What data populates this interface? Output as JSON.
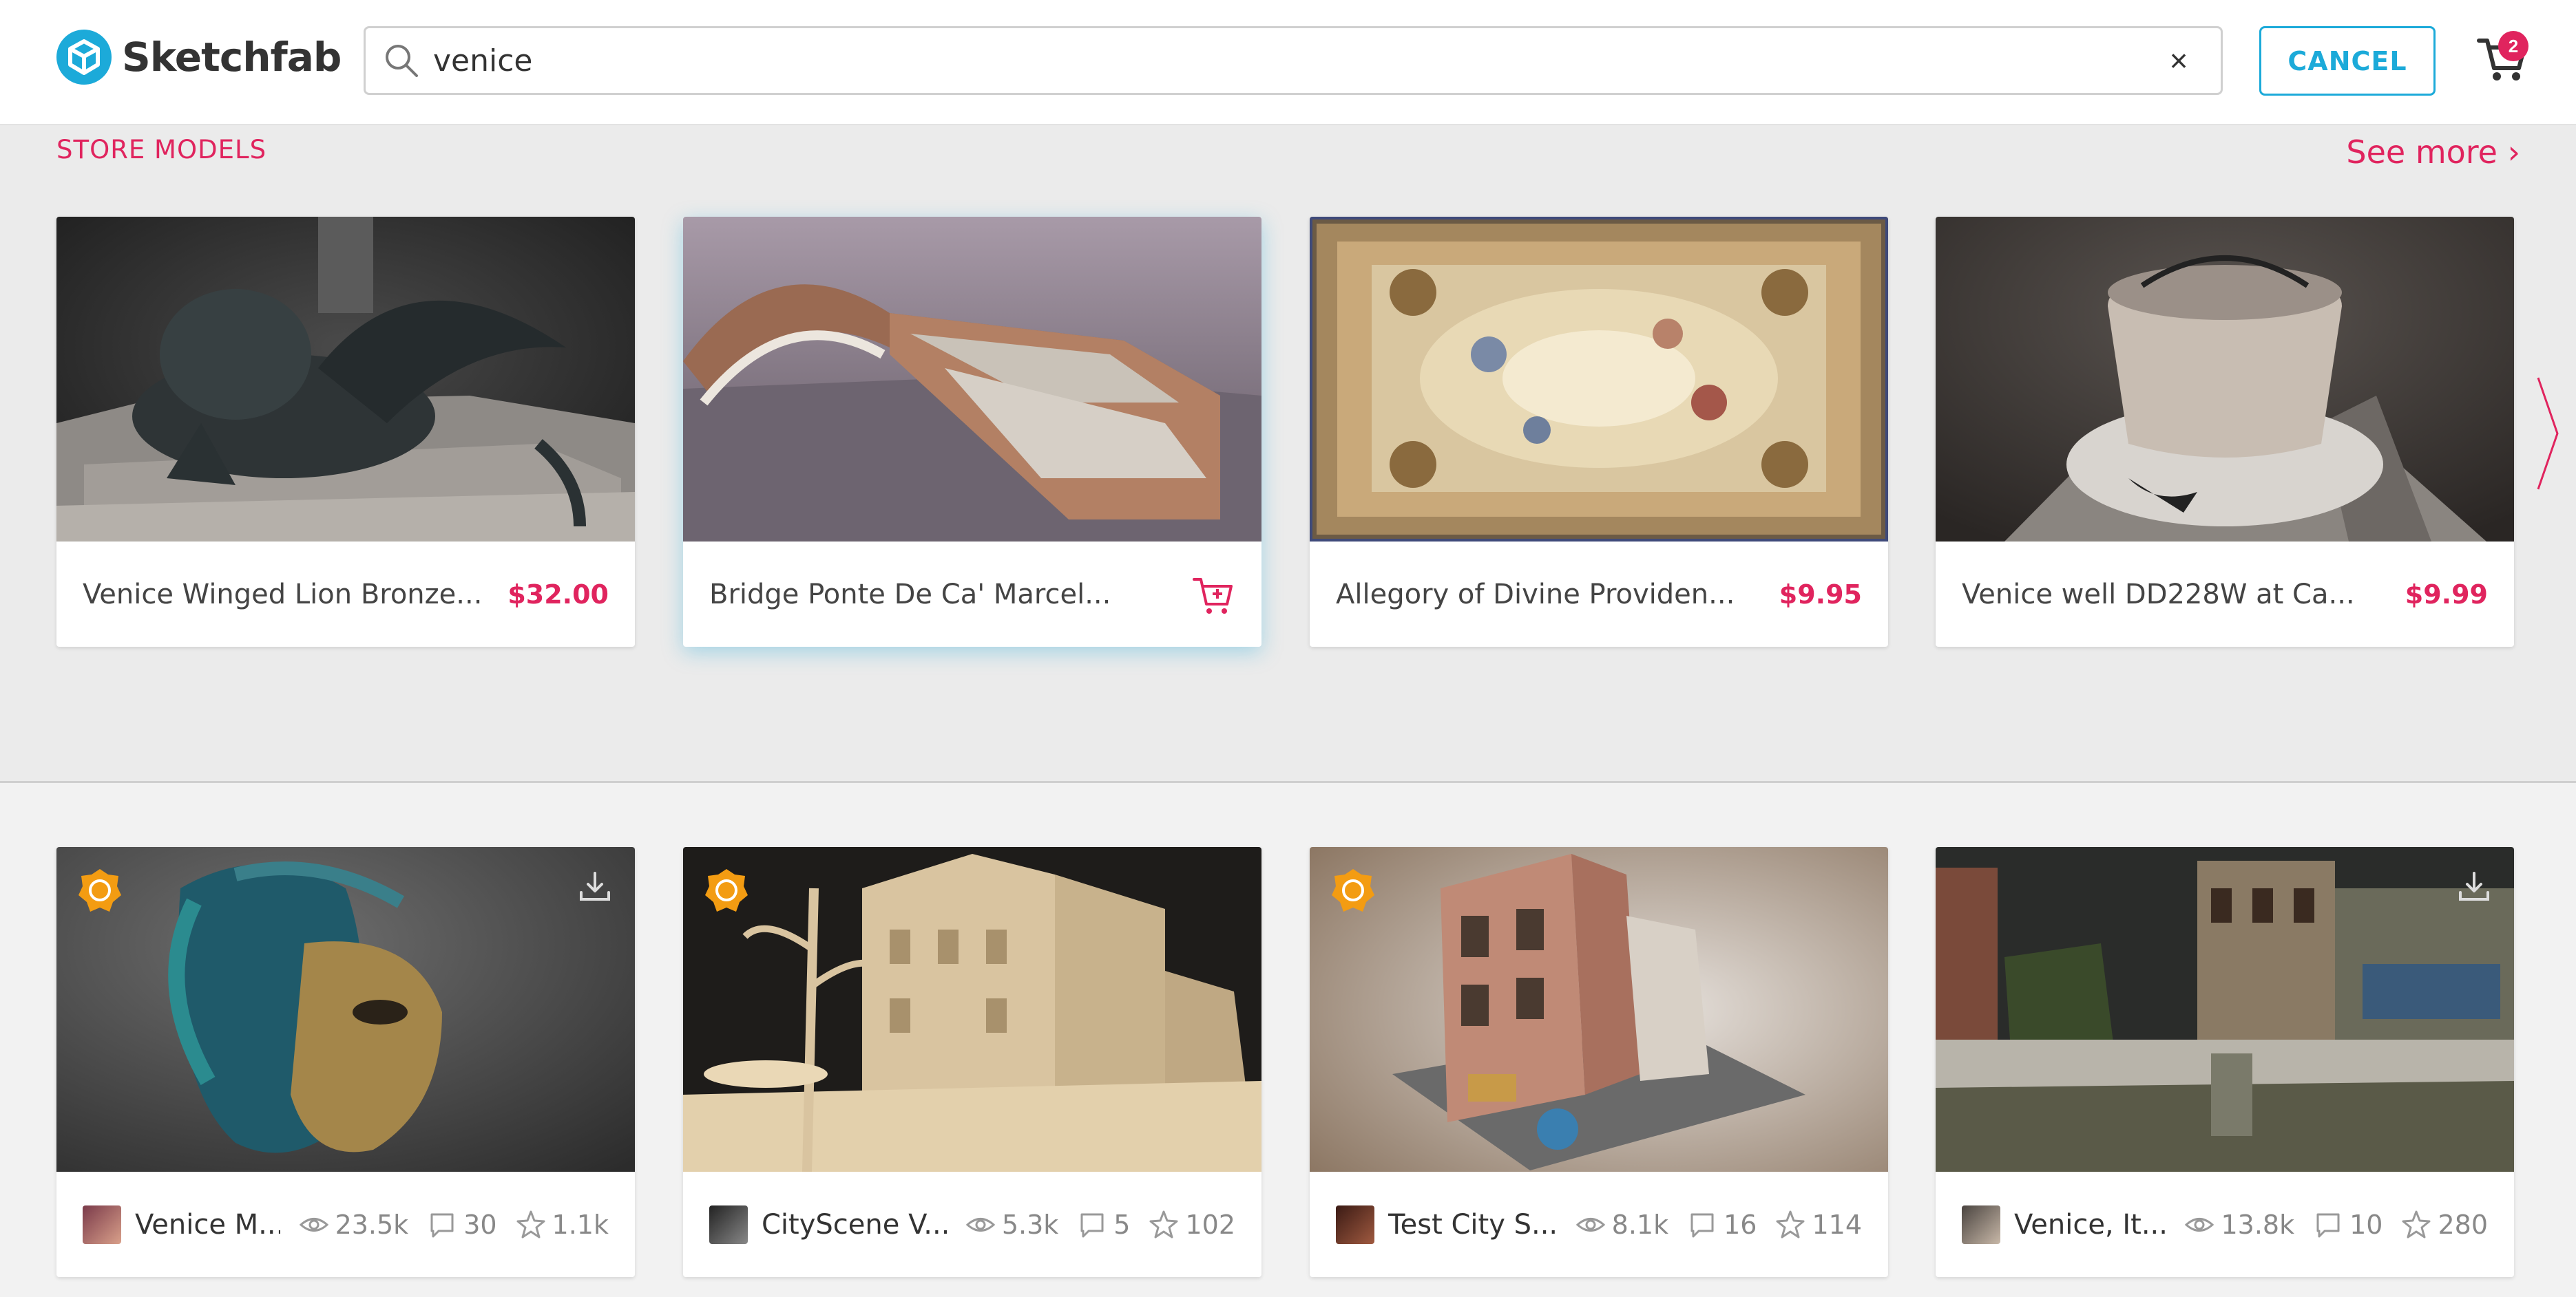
{
  "app": {
    "name": "Sketchfab"
  },
  "search": {
    "value": "venice",
    "clear_label": "×"
  },
  "header": {
    "cancel_label": "CANCEL",
    "cart_badge": "2"
  },
  "store": {
    "title": "STORE MODELS",
    "see_more": "See more ›",
    "items": [
      {
        "name": "Venice Winged Lion Bronze...",
        "price": "$32.00"
      },
      {
        "name": "Bridge Ponte De Ca' Marcel...",
        "price": ""
      },
      {
        "name": "Allegory of Divine Providen...",
        "price": "$9.95"
      },
      {
        "name": "Venice well DD228W at Ca...",
        "price": "$9.99"
      }
    ]
  },
  "models": [
    {
      "name": "Venice M...",
      "views": "23.5k",
      "comments": "30",
      "likes": "1.1k"
    },
    {
      "name": "CityScene V...",
      "views": "5.3k",
      "comments": "5",
      "likes": "102"
    },
    {
      "name": "Test City S...",
      "views": "8.1k",
      "comments": "16",
      "likes": "114"
    },
    {
      "name": "Venice, It...",
      "views": "13.8k",
      "comments": "10",
      "likes": "280"
    }
  ],
  "colors": {
    "accent": "#1caad9",
    "brand_pink": "#e0245e",
    "staff_badge": "#f39c12"
  }
}
